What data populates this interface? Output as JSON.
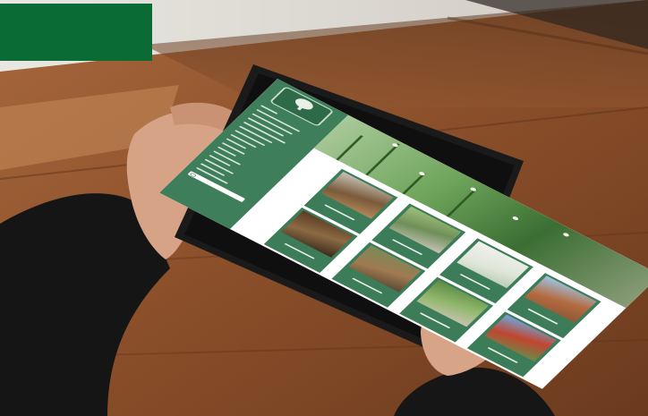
{
  "photo": {
    "description_colors": {
      "table": "#8a4f2a",
      "tablet_bezel": "#1c1c1c",
      "sleeve": "#141414",
      "skin": "#d9a58a"
    }
  },
  "brand": {
    "color": "#0a6b35"
  },
  "tablet_screen": {
    "sidebar_color": "#3f7e5b",
    "tile_color": "#3c7c59",
    "nav_items": 16,
    "tiles": 8
  }
}
